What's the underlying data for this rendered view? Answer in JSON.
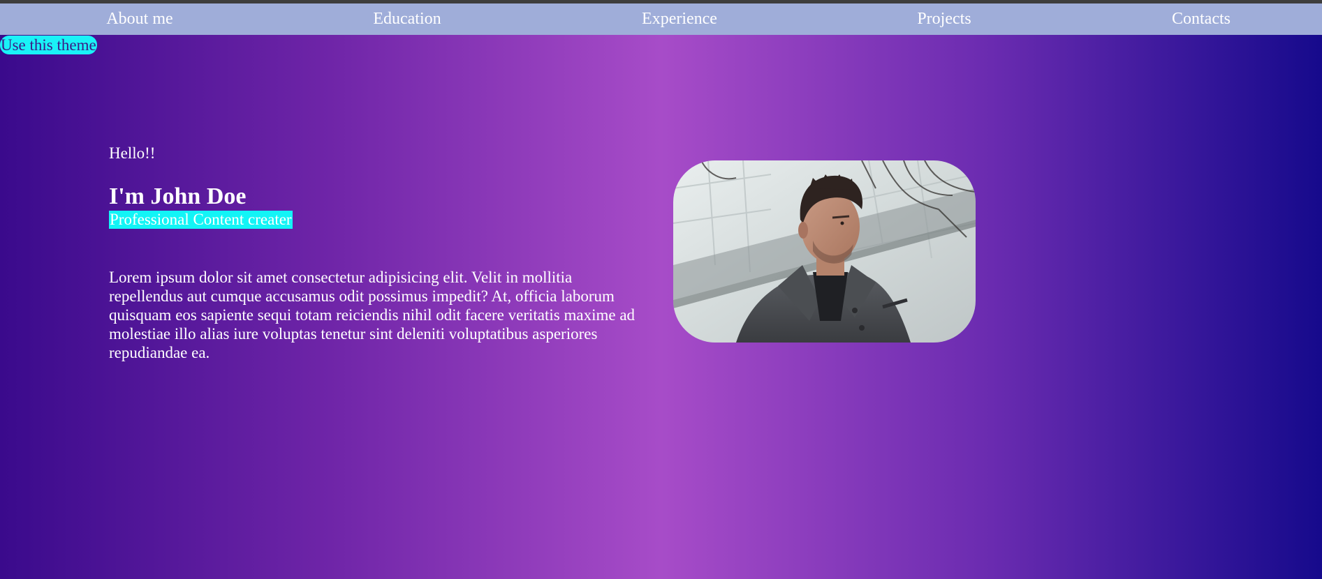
{
  "nav": {
    "items": [
      {
        "label": "About me"
      },
      {
        "label": "Education"
      },
      {
        "label": "Experience"
      },
      {
        "label": "Projects"
      },
      {
        "label": "Contacts"
      }
    ]
  },
  "theme_button": {
    "label": "Use this theme"
  },
  "hero": {
    "greeting": "Hello!!",
    "name": "I'm John Doe",
    "role": "Professional Content creater",
    "description": "Lorem ipsum dolor sit amet consectetur adipisicing elit. Velit in mollitia repellendus aut cumque accusamus odit possimus impedit? At, officia laborum quisquam eos sapiente sequi totam reiciendis nihil odit facere veritatis maxime ad molestiae illo alias iure voluptas tenetur sint deleniti voluptatibus asperiores repudiandae ea.",
    "photo_icon": "profile-photo"
  },
  "colors": {
    "nav_bg": "#9fadd9",
    "accent": "#12f4f6",
    "gradient_left": "#3a0a8c",
    "gradient_mid": "#a74cc8",
    "gradient_right": "#160a8c"
  }
}
